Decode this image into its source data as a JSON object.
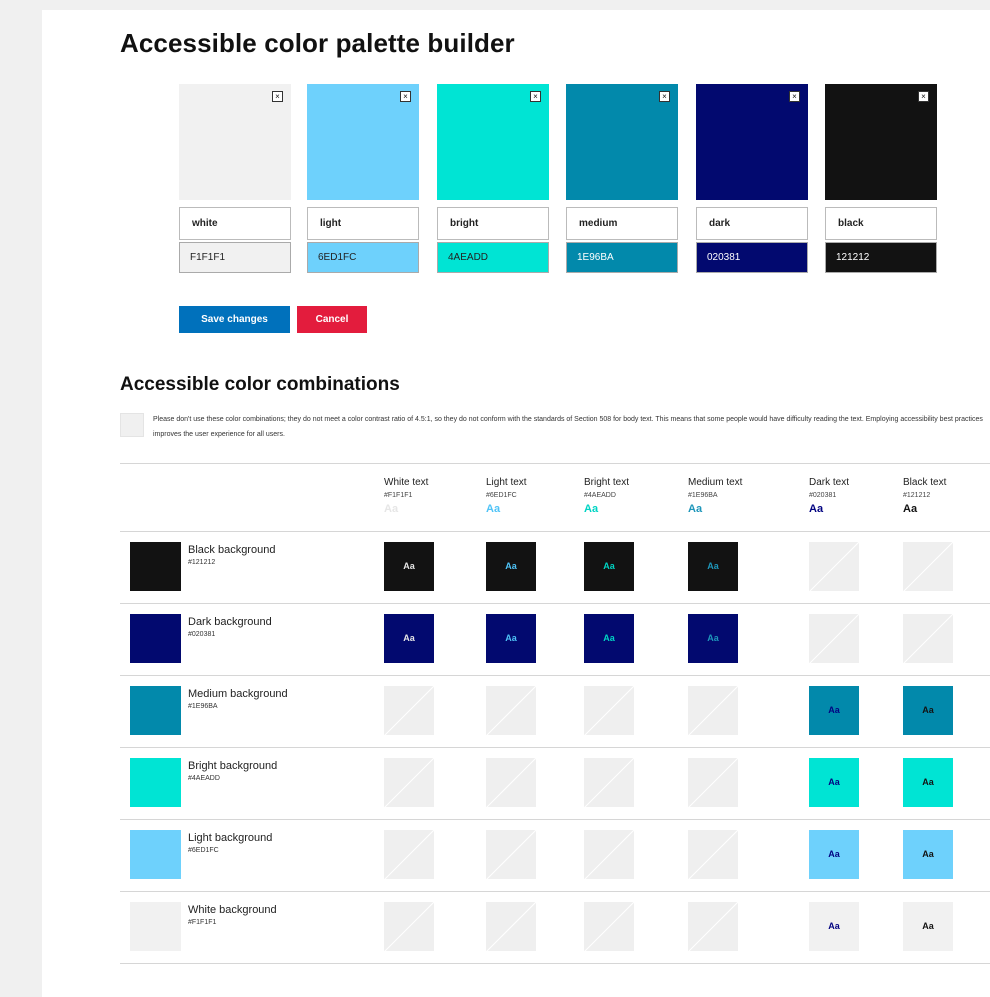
{
  "title": "Accessible color palette builder",
  "palette": [
    {
      "key": "white",
      "name": "white",
      "hex": "F1F1F1",
      "color": "#f1f1f1",
      "text": "#222222"
    },
    {
      "key": "light",
      "name": "light",
      "hex": "6ED1FC",
      "color": "#6ed1fc",
      "text": "#222222"
    },
    {
      "key": "bright",
      "name": "bright",
      "hex": "4AEADD",
      "color": "#00e4d4",
      "text": "#222222"
    },
    {
      "key": "medium",
      "name": "medium",
      "hex": "1E96BA",
      "color": "#0289ab",
      "text": "#ffffff"
    },
    {
      "key": "dark",
      "name": "dark",
      "hex": "020381",
      "color": "#02096f",
      "text": "#ffffff"
    },
    {
      "key": "black",
      "name": "black",
      "hex": "121212",
      "color": "#121212",
      "text": "#ffffff"
    }
  ],
  "close_glyph": "×",
  "buttons": {
    "save": "Save changes",
    "cancel": "Cancel"
  },
  "combinations": {
    "title": "Accessible color combinations",
    "notice": "Please don't use these color combinations; they do not meet a color contrast ratio of 4.5:1, so they do not conform with the standards of Section 508 for body text. This means that some people would have difficulty reading the text. Employing accessibility best practices improves the user experience for all users.",
    "sample": "Aa",
    "columns": [
      {
        "name": "White text",
        "hex": "#F1F1F1",
        "color": "#e6e6e6"
      },
      {
        "name": "Light text",
        "hex": "#6ED1FC",
        "color": "#4fc3f7"
      },
      {
        "name": "Bright text",
        "hex": "#4AEADD",
        "color": "#00d4c4"
      },
      {
        "name": "Medium text",
        "hex": "#1E96BA",
        "color": "#1e96ba"
      },
      {
        "name": "Dark text",
        "hex": "#020381",
        "color": "#020381"
      },
      {
        "name": "Black text",
        "hex": "#121212",
        "color": "#121212"
      }
    ],
    "rows": [
      {
        "name": "Black background",
        "hex": "#121212",
        "color": "#121212",
        "passes": [
          true,
          true,
          true,
          true,
          false,
          false
        ]
      },
      {
        "name": "Dark background",
        "hex": "#020381",
        "color": "#02096f",
        "passes": [
          true,
          true,
          true,
          true,
          false,
          false
        ]
      },
      {
        "name": "Medium background",
        "hex": "#1E96BA",
        "color": "#0289ab",
        "passes": [
          false,
          false,
          false,
          false,
          true,
          true
        ]
      },
      {
        "name": "Bright background",
        "hex": "#4AEADD",
        "color": "#00e4d4",
        "passes": [
          false,
          false,
          false,
          false,
          true,
          true
        ]
      },
      {
        "name": "Light background",
        "hex": "#6ED1FC",
        "color": "#6ed1fc",
        "passes": [
          false,
          false,
          false,
          false,
          true,
          true
        ]
      },
      {
        "name": "White background",
        "hex": "#F1F1F1",
        "color": "#f1f1f1",
        "passes": [
          false,
          false,
          false,
          false,
          true,
          true
        ]
      }
    ]
  }
}
